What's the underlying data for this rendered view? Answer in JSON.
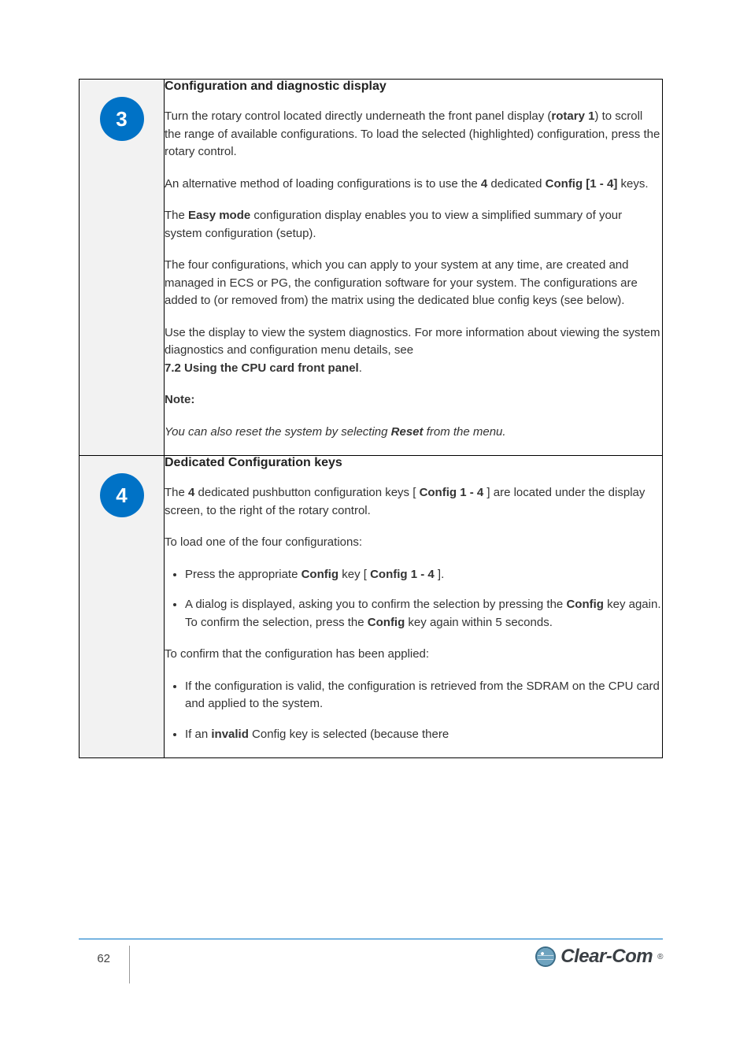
{
  "rows": [
    {
      "key_num": "3",
      "title": "Configuration and diagnostic display",
      "paras": [
        {
          "html": "Turn the rotary control located directly underneath the front panel display (<strong>rotary 1</strong>) to scroll the range of available configurations. To load the selected (highlighted) configuration, press the rotary control."
        },
        {
          "html": "An alternative method of loading configurations is to use the <strong>4</strong> dedicated <strong>Config [1 - 4]</strong> keys."
        },
        {
          "html": "The <strong>Easy mode</strong> configuration display enables you to view a simplified summary of your system configuration (setup)."
        },
        {
          "html": "The four configurations, which you can apply to your system at any time, are created and managed in ECS or PG, the configuration software for your system. The configurations are added to (or removed from) the matrix using the dedicated blue config keys (see below)."
        },
        {
          "html": "Use the display to view the system diagnostics. For more information about viewing the system diagnostics and configuration menu details, see<br><strong>7.2 Using the CPU card front panel</strong>."
        },
        {
          "html": "<strong>Note:</strong>"
        },
        {
          "html": "<em>You can also reset the system by selecting <strong>Reset</strong> from the menu.</em>"
        }
      ],
      "bullets": []
    },
    {
      "key_num": "4",
      "title": "Dedicated Configuration keys",
      "paras": [
        {
          "html": "The <strong>4</strong> dedicated pushbutton configuration keys [ <strong>Config 1 - 4</strong> ] are located under the display screen, to the right of the rotary control."
        },
        {
          "html": "To load one of the four configurations:"
        }
      ],
      "bullets": [
        {
          "html": "Press the appropriate <strong>Config</strong> key [ <strong>Config 1 - 4</strong> ]."
        },
        {
          "html": "A dialog is displayed, asking you to confirm the selection by pressing the <strong>Config</strong> key again.<br>To confirm the selection, press the <strong>Config</strong> key again within 5 seconds."
        },
        {
          "html": "If the configuration is valid, the configuration is retrieved from the SDRAM on the CPU card and applied to the system."
        },
        {
          "html": "If an <strong>invalid</strong> Config key is selected (because there"
        }
      ],
      "paras2": [
        {
          "html": "To confirm that the configuration has been applied:"
        }
      ]
    }
  ],
  "footer": {
    "page": "62",
    "brand": "Clear-Com"
  }
}
